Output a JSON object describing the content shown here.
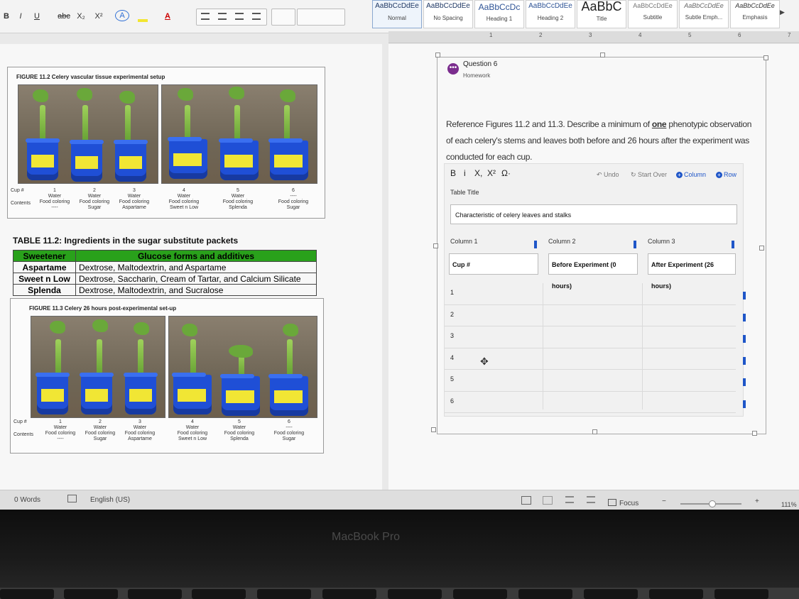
{
  "ribbon": {
    "format_buttons": [
      "B",
      "I",
      "U",
      "abc",
      "X₂",
      "X²",
      "A",
      "A"
    ],
    "styles": [
      {
        "sample": "AaBbCcDdEe",
        "name": "Normal"
      },
      {
        "sample": "AaBbCcDdEe",
        "name": "No Spacing"
      },
      {
        "sample": "AaBbCcDc",
        "name": "Heading 1"
      },
      {
        "sample": "AaBbCcDdEe",
        "name": "Heading 2"
      },
      {
        "sample": "AaBbC",
        "name": "Title"
      },
      {
        "sample": "AaBbCcDdEe",
        "name": "Subtitle"
      },
      {
        "sample": "AaBbCcDdEe",
        "name": "Subtle Emph..."
      },
      {
        "sample": "AaBbCcDdEe",
        "name": "Emphasis"
      }
    ]
  },
  "ruler": {
    "numbers": [
      "1",
      "2",
      "3",
      "4",
      "5",
      "6",
      "7"
    ]
  },
  "left_page": {
    "fig1_title": "FIGURE 11.2 Celery vascular tissue experimental setup",
    "fig2_title": "FIGURE 11.3 Celery 26 hours post-experimental set-up",
    "cup_header": "Cup #",
    "contents_header": "Contents",
    "cups": [
      {
        "num": "1",
        "line1": "Water",
        "line2": "Food coloring",
        "line3": "----"
      },
      {
        "num": "2",
        "line1": "Water",
        "line2": "Food coloring",
        "line3": "Sugar"
      },
      {
        "num": "3",
        "line1": "Water",
        "line2": "Food coloring",
        "line3": "Aspartame"
      },
      {
        "num": "4",
        "line1": "Water",
        "line2": "Food coloring",
        "line3": "Sweet n Low"
      },
      {
        "num": "5",
        "line1": "Water",
        "line2": "Food coloring",
        "line3": "Splenda"
      },
      {
        "num": "6",
        "line1": "----",
        "line2": "Food coloring",
        "line3": "Sugar"
      }
    ],
    "table_title": "TABLE 11.2: Ingredients in the sugar substitute packets",
    "table_headers": [
      "Sweetener",
      "Glucose forms and additives"
    ],
    "table_rows": [
      [
        "Aspartame",
        "Dextrose, Maltodextrin, and Aspartame"
      ],
      [
        "Sweet n Low",
        "Dextrose, Saccharin, Cream of Tartar, and Calcium Silicate"
      ],
      [
        "Splenda",
        "Dextrose, Maltodextrin, and Sucralose"
      ]
    ]
  },
  "status_bar": {
    "words": "0 Words",
    "language": "English (US)",
    "focus": "Focus",
    "zoom": "111%"
  },
  "question": {
    "title": "Question 6",
    "subtitle": "Homework",
    "prompt_before": "Reference Figures 11.2 and 11.3.  Describe a minimum of ",
    "prompt_bold": "one",
    "prompt_after": " phenotypic observation of each celery's stems and leaves both before and 26 hours after the experiment was conducted for each cup.",
    "toolbar": {
      "bold": "B",
      "italic": "i",
      "sub": "X,",
      "sup": "X²",
      "omega": "Ω·",
      "undo": "Undo",
      "start_over": "Start Over",
      "column": "Column",
      "row": "Row"
    },
    "table_title_label": "Table Title",
    "table_title_value": "Characteristic of celery leaves and stalks",
    "columns": [
      {
        "label": "Column 1",
        "value": "Cup #"
      },
      {
        "label": "Column 2",
        "value": "Before Experiment (0 hours)"
      },
      {
        "label": "Column 3",
        "value": "After Experiment (26 hours)"
      }
    ],
    "rows": [
      "1",
      "2",
      "3",
      "4",
      "5",
      "6"
    ]
  },
  "laptop": {
    "brand": "MacBook Pro"
  }
}
